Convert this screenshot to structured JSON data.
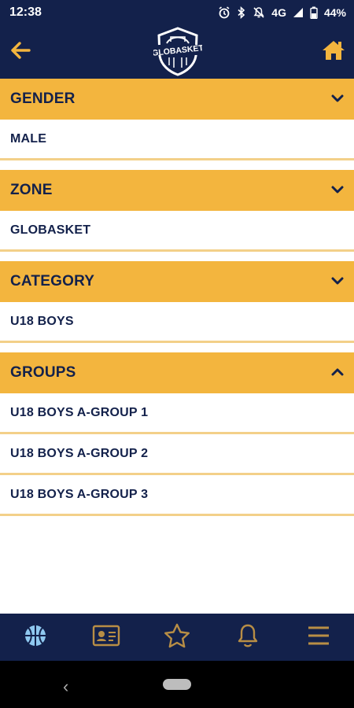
{
  "status_bar": {
    "time": "12:38",
    "network": "4G",
    "battery": "44%",
    "icons": [
      "alarm-icon",
      "bluetooth-icon",
      "mute-icon",
      "signal-icon",
      "battery-icon"
    ]
  },
  "app_bar": {
    "back_icon": "arrow-left-icon",
    "logo_text": "GLOBASKET",
    "home_icon": "home-icon"
  },
  "sections": [
    {
      "title": "GENDER",
      "expanded": false,
      "items": [
        "MALE"
      ]
    },
    {
      "title": "ZONE",
      "expanded": false,
      "items": [
        "GLOBASKET"
      ]
    },
    {
      "title": "CATEGORY",
      "expanded": false,
      "items": [
        "U18 BOYS"
      ]
    },
    {
      "title": "GROUPS",
      "expanded": true,
      "items": [
        "U18 BOYS A-GROUP 1",
        "U18 BOYS A-GROUP 2",
        "U18 BOYS A-GROUP 3"
      ]
    }
  ],
  "bottom_nav": [
    {
      "icon": "basketball-icon",
      "active": true
    },
    {
      "icon": "id-card-icon",
      "active": false
    },
    {
      "icon": "star-icon",
      "active": false
    },
    {
      "icon": "bell-icon",
      "active": false
    },
    {
      "icon": "menu-icon",
      "active": false
    }
  ],
  "colors": {
    "navy": "#13214b",
    "gold": "#f3b53e",
    "active_nav": "#8fc8ef",
    "inactive_nav": "#b88e45"
  }
}
